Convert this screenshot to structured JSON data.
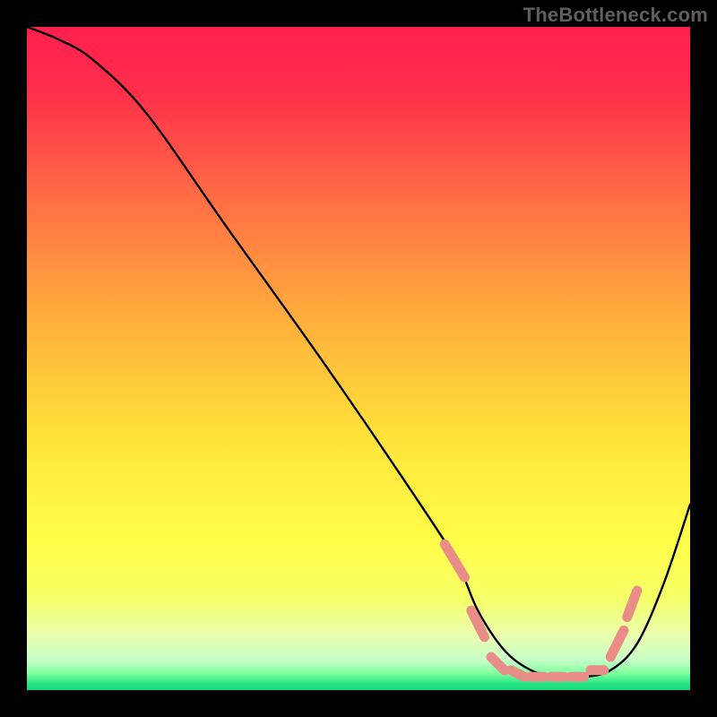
{
  "watermark": "TheBottleneck.com",
  "chart_data": {
    "type": "line",
    "title": "",
    "xlabel": "",
    "ylabel": "",
    "xlim": [
      0,
      100
    ],
    "ylim": [
      0,
      100
    ],
    "gradient_stops": [
      {
        "offset": 0.0,
        "color": "#ff1f4f"
      },
      {
        "offset": 0.1,
        "color": "#ff2f4a"
      },
      {
        "offset": 0.25,
        "color": "#ff6a45"
      },
      {
        "offset": 0.45,
        "color": "#ffb13b"
      },
      {
        "offset": 0.62,
        "color": "#ffe33a"
      },
      {
        "offset": 0.78,
        "color": "#ffff4a"
      },
      {
        "offset": 0.86,
        "color": "#f6ff66"
      },
      {
        "offset": 0.92,
        "color": "#e8ffb0"
      },
      {
        "offset": 0.955,
        "color": "#c6ffc6"
      },
      {
        "offset": 0.975,
        "color": "#7dff9d"
      },
      {
        "offset": 0.99,
        "color": "#28e584"
      },
      {
        "offset": 1.0,
        "color": "#17d77a"
      }
    ],
    "series": [
      {
        "name": "bottleneck-curve",
        "x": [
          0,
          5,
          10,
          18,
          30,
          45,
          60,
          65,
          68,
          72,
          76,
          80,
          84,
          88,
          92,
          96,
          100
        ],
        "values": [
          100,
          98,
          95,
          87,
          70,
          49,
          27,
          19,
          12,
          6,
          3,
          2,
          2,
          3,
          7,
          16,
          28
        ]
      }
    ],
    "markers": {
      "name": "highlight-segments",
      "color": "#e98d88",
      "segments": [
        {
          "x0": 63,
          "y0": 22,
          "x1": 66,
          "y1": 17
        },
        {
          "x0": 67,
          "y0": 12,
          "x1": 69,
          "y1": 8
        },
        {
          "x0": 70,
          "y0": 5,
          "x1": 72,
          "y1": 3
        },
        {
          "x0": 73,
          "y0": 3,
          "x1": 75,
          "y1": 2
        },
        {
          "x0": 76,
          "y0": 2,
          "x1": 78,
          "y1": 2
        },
        {
          "x0": 79,
          "y0": 2,
          "x1": 81,
          "y1": 2
        },
        {
          "x0": 82,
          "y0": 2,
          "x1": 84,
          "y1": 2
        },
        {
          "x0": 85,
          "y0": 3,
          "x1": 87,
          "y1": 3
        },
        {
          "x0": 88,
          "y0": 5,
          "x1": 90,
          "y1": 9
        },
        {
          "x0": 90.5,
          "y0": 11,
          "x1": 92,
          "y1": 15
        }
      ]
    }
  }
}
